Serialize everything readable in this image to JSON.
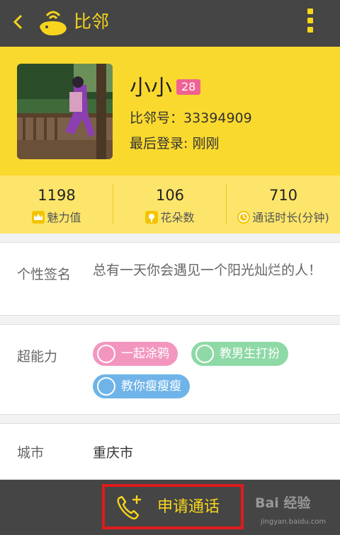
{
  "header": {
    "title": "比邻",
    "icons": {
      "back": "back-arrow-icon",
      "logo": "whale-logo-icon",
      "more": "more-menu-icon"
    }
  },
  "profile": {
    "name": "小小",
    "age": "28",
    "id_line": "比邻号：33394909",
    "last_login": "最后登录: 刚刚"
  },
  "stats": [
    {
      "value": "1198",
      "label": "魅力值",
      "icon": "crown-icon"
    },
    {
      "value": "106",
      "label": "花朵数",
      "icon": "flower-icon"
    },
    {
      "value": "710",
      "label": "通话时长(分钟)",
      "icon": "clock-icon"
    }
  ],
  "signature": {
    "label": "个性签名",
    "text": "总有一天你会遇见一个阳光灿烂的人！"
  },
  "skills": {
    "label": "超能力",
    "tags": [
      {
        "text": "一起涂鸦",
        "color": "#f296bf",
        "icon": "palette-icon"
      },
      {
        "text": "教男生打扮",
        "color": "#8ed9a6",
        "icon": "hair-icon"
      },
      {
        "text": "教你瘦瘦瘦",
        "color": "#6fb4e8",
        "icon": "body-icon"
      }
    ]
  },
  "city": {
    "label": "城市",
    "value": "重庆市"
  },
  "footer": {
    "call_label": "申请通话",
    "watermark_brand": "Bai 经验",
    "watermark_url": "jingyan.baidu.com"
  },
  "colors": {
    "accent": "#f7d51c",
    "bar": "#454545",
    "profile_bg": "#fad92e",
    "highlight_box": "#e01b1b"
  }
}
